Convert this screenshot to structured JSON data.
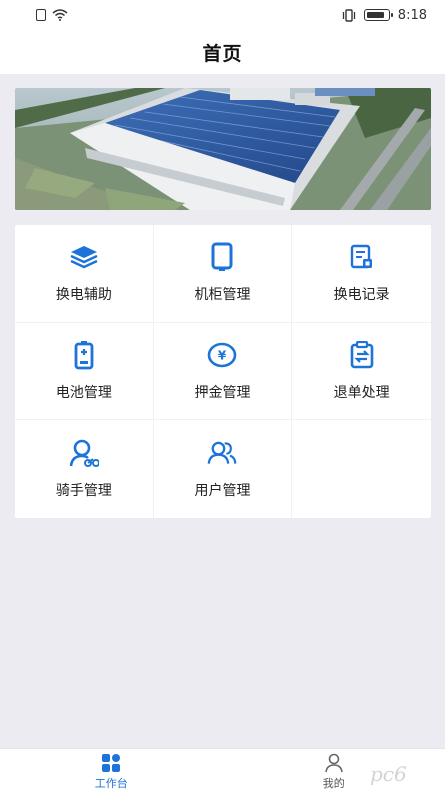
{
  "status_bar": {
    "time": "8:18",
    "icons": [
      "sim-icon",
      "wifi-icon",
      "vibrate-icon",
      "battery-icon"
    ]
  },
  "header": {
    "title": "首页"
  },
  "banner": {
    "image": "solar-factory-aerial-photo"
  },
  "menu": {
    "items": [
      {
        "label": "换电辅助",
        "icon": "layers-icon"
      },
      {
        "label": "机柜管理",
        "icon": "cabinet-icon"
      },
      {
        "label": "换电记录",
        "icon": "record-icon"
      },
      {
        "label": "电池管理",
        "icon": "battery-icon"
      },
      {
        "label": "押金管理",
        "icon": "yen-icon"
      },
      {
        "label": "退单处理",
        "icon": "return-order-icon"
      },
      {
        "label": "骑手管理",
        "icon": "rider-icon"
      },
      {
        "label": "用户管理",
        "icon": "users-icon"
      }
    ]
  },
  "tabbar": {
    "tabs": [
      {
        "label": "工作台",
        "icon": "grid-icon",
        "active": true
      },
      {
        "label": "我的",
        "icon": "person-icon",
        "active": false
      }
    ]
  },
  "watermark": "pc6",
  "colors": {
    "accent": "#1e73d8",
    "background": "#ecebf2",
    "card": "#ffffff"
  }
}
